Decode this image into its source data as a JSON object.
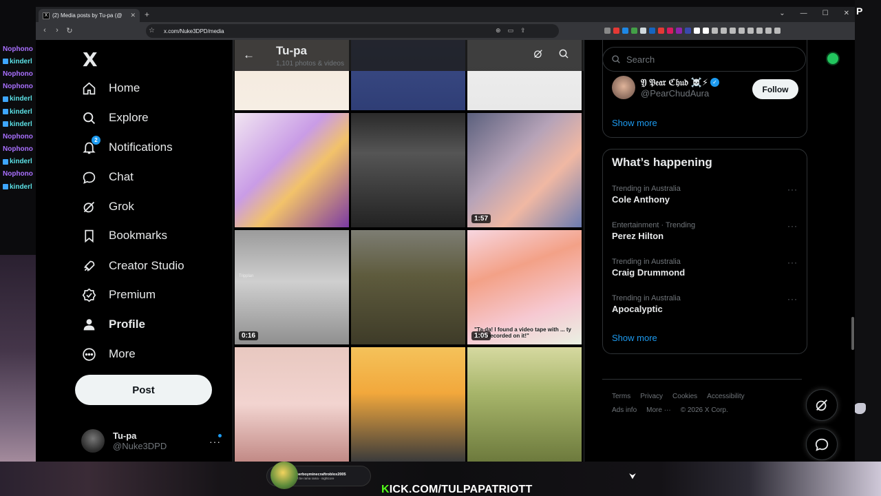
{
  "stream": {
    "chat_lines": [
      {
        "user": "Nophono",
        "color": "#a970ff",
        "badge": false
      },
      {
        "user": "kinderl",
        "color": "#5ce1e6",
        "badge": true
      },
      {
        "user": "Nophono",
        "color": "#a970ff",
        "badge": false
      },
      {
        "user": "Nophono",
        "color": "#a970ff",
        "badge": false
      },
      {
        "user": "kinderl",
        "color": "#5ce1e6",
        "badge": true
      },
      {
        "user": "kinderl",
        "color": "#5ce1e6",
        "badge": true
      },
      {
        "user": "kinderl",
        "color": "#5ce1e6",
        "badge": true
      },
      {
        "user": "Nophono",
        "color": "#a970ff",
        "badge": false
      },
      {
        "user": "Nophono",
        "color": "#a970ff",
        "badge": false
      },
      {
        "user": "kinderl",
        "color": "#5ce1e6",
        "badge": true
      },
      {
        "user": "Nophono",
        "color": "#a970ff",
        "badge": false
      },
      {
        "user": "kinderl",
        "color": "#5ce1e6",
        "badge": true
      }
    ],
    "kick_prefix": "K",
    "kick_rest": "ICK.COM/TULPAPATRIOTT",
    "sub_user": "superboyminecraftroblox2005",
    "sub_text": "don't be rama rama - nightcore",
    "edge_letter": "P"
  },
  "browser": {
    "tab_title": "(2) Media posts by Tu-pa (@",
    "tab_favicon": "X",
    "url": "x.com/Nuke3DPD/media",
    "ext_colors": [
      "#888",
      "#e53935",
      "#1e88e5",
      "#43a047",
      "#cfd8dc",
      "#1565c0",
      "#e53935",
      "#d81b60",
      "#8e24aa",
      "#3949ab",
      "#fff",
      "#fff",
      "#bbb",
      "#bbb",
      "#bbb",
      "#bbb",
      "#bbb",
      "#bbb",
      "#bbb",
      "#bbb"
    ]
  },
  "nav": {
    "logo": "X",
    "items": [
      {
        "label": "Home",
        "icon": "home-icon"
      },
      {
        "label": "Explore",
        "icon": "search-icon"
      },
      {
        "label": "Notifications",
        "icon": "bell-icon",
        "badge": "2"
      },
      {
        "label": "Chat",
        "icon": "chat-bubble-icon"
      },
      {
        "label": "Grok",
        "icon": "grok-icon"
      },
      {
        "label": "Bookmarks",
        "icon": "bookmark-icon"
      },
      {
        "label": "Creator Studio",
        "icon": "rocket-icon"
      },
      {
        "label": "Premium",
        "icon": "verified-badge-icon"
      },
      {
        "label": "Profile",
        "icon": "person-icon",
        "active": true
      },
      {
        "label": "More",
        "icon": "more-circle-icon"
      }
    ],
    "post_label": "Post",
    "account_name": "Tu-pa",
    "account_handle": "@Nuke3DPD",
    "more_dots": "···"
  },
  "media": {
    "title": "Tu-pa",
    "subtitle": "1,101 photos & videos",
    "tiles": [
      {
        "bg": "linear-gradient(180deg,#f3e6d8 0%,#f6eee4 100%)",
        "accent": "#e9a860"
      },
      {
        "bg": "linear-gradient(180deg,#f5f0ec 0%,#3f4f8a 30%,#2f3e76 100%)",
        "accent": "#fff"
      },
      {
        "bg": "linear-gradient(180deg,#f4f4f4 0%,#e8e8e8 100%)",
        "accent": "#333"
      },
      {
        "bg": "linear-gradient(135deg,#f1e5f1 0%,#c99ce6 40%,#f2c26a 60%,#7b3aa3 100%)",
        "accent": ""
      },
      {
        "bg": "linear-gradient(180deg,#2a2a2a 0%,#555 35%,#222 100%)",
        "accent": ""
      },
      {
        "bg": "linear-gradient(135deg,#5b607d 0%,#b6a3b8 40%,#f0b8a3 65%,#6b7bb0 100%)",
        "duration": "1:57"
      },
      {
        "bg": "linear-gradient(180deg,#9b9b9b 0%,#cfcfcf 45%,#8f8f8f 100%)",
        "duration": "0:16",
        "watermark": "Tripplan"
      },
      {
        "bg": "linear-gradient(180deg,#7d7d73 0%,#5e5b3d 40%,#3e3b28 100%)"
      },
      {
        "bg": "linear-gradient(160deg,#f7d6e0 0%,#f3a187 35%,#f6c9d2 70%,#eaf1e3 100%)",
        "duration": "1:05",
        "caption": "\"Ta-da! I found a video tape with ... ty Cute recorded on it!\""
      },
      {
        "bg": "linear-gradient(180deg,#e8c8c0 0%,#f2d4d0 50%,#c28a86 100%)"
      },
      {
        "bg": "linear-gradient(180deg,#f4c25a 0%,#f2a83c 40%,#3b3b3b 100%)"
      },
      {
        "bg": "linear-gradient(180deg,#d6d9a0 0%,#a7b56a 40%,#6d7a3d 100%)"
      }
    ]
  },
  "right": {
    "search_placeholder": "Search",
    "who_name": "𝔜 𝔓𝔢𝔞𝔯 ℭ𝔥𝔲𝔡 ☠️⚡",
    "who_handle": "@PearChudAura",
    "follow_label": "Follow",
    "show_more": "Show more",
    "whats_happening": "What’s happening",
    "trends": [
      {
        "context": "Trending in Australia",
        "name": "Cole Anthony"
      },
      {
        "context": "Entertainment · Trending",
        "name": "Perez Hilton"
      },
      {
        "context": "Trending in Australia",
        "name": "Craig Drummond"
      },
      {
        "context": "Trending in Australia",
        "name": "Apocalyptic"
      }
    ],
    "trend_dots": "···",
    "footer": [
      "Terms",
      "Privacy",
      "Cookies",
      "Accessibility",
      "Ads info",
      "More ···",
      "© 2026 X Corp."
    ]
  }
}
